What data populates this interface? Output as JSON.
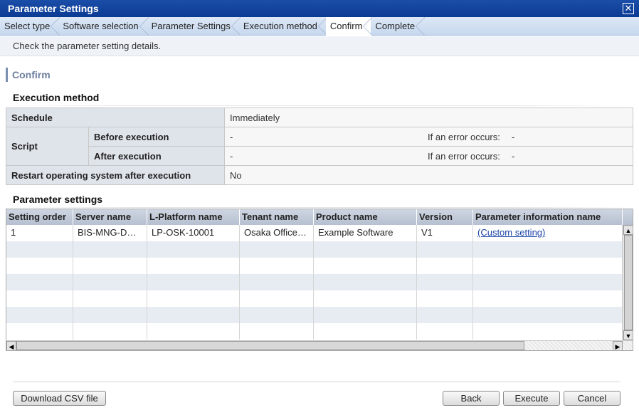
{
  "window": {
    "title": "Parameter Settings",
    "close_glyph": "✕"
  },
  "steps": [
    {
      "label": "Select type",
      "active": false
    },
    {
      "label": "Software selection",
      "active": false
    },
    {
      "label": "Parameter Settings",
      "active": false
    },
    {
      "label": "Execution method",
      "active": false
    },
    {
      "label": "Confirm",
      "active": true
    },
    {
      "label": "Complete",
      "active": false
    }
  ],
  "instruction": "Check the parameter setting details.",
  "page_title": "Confirm",
  "execution": {
    "header": "Execution method",
    "schedule_label": "Schedule",
    "schedule_value": "Immediately",
    "script_label": "Script",
    "before_label": "Before execution",
    "before_value": "-",
    "before_error_label": "If an error occurs:",
    "before_error_value": "-",
    "after_label": "After execution",
    "after_value": "-",
    "after_error_label": "If an error occurs:",
    "after_error_value": "-",
    "restart_label": "Restart operating system after execution",
    "restart_value": "No"
  },
  "parameters": {
    "header": "Parameter settings",
    "columns": [
      "Setting order",
      "Server name",
      "L-Platform name",
      "Tenant name",
      "Product name",
      "Version",
      "Parameter information name"
    ],
    "rows": [
      [
        "1",
        "BIS-MNG-D…",
        "LP-OSK-10001",
        "Osaka Office…",
        "Example Software",
        "V1",
        "(Custom setting)"
      ]
    ],
    "empty_rows": 6
  },
  "buttons": {
    "download": "Download CSV file",
    "back": "Back",
    "execute": "Execute",
    "cancel": "Cancel"
  },
  "scroll_glyphs": {
    "up": "▲",
    "down": "▼",
    "left": "◀",
    "right": "▶"
  }
}
